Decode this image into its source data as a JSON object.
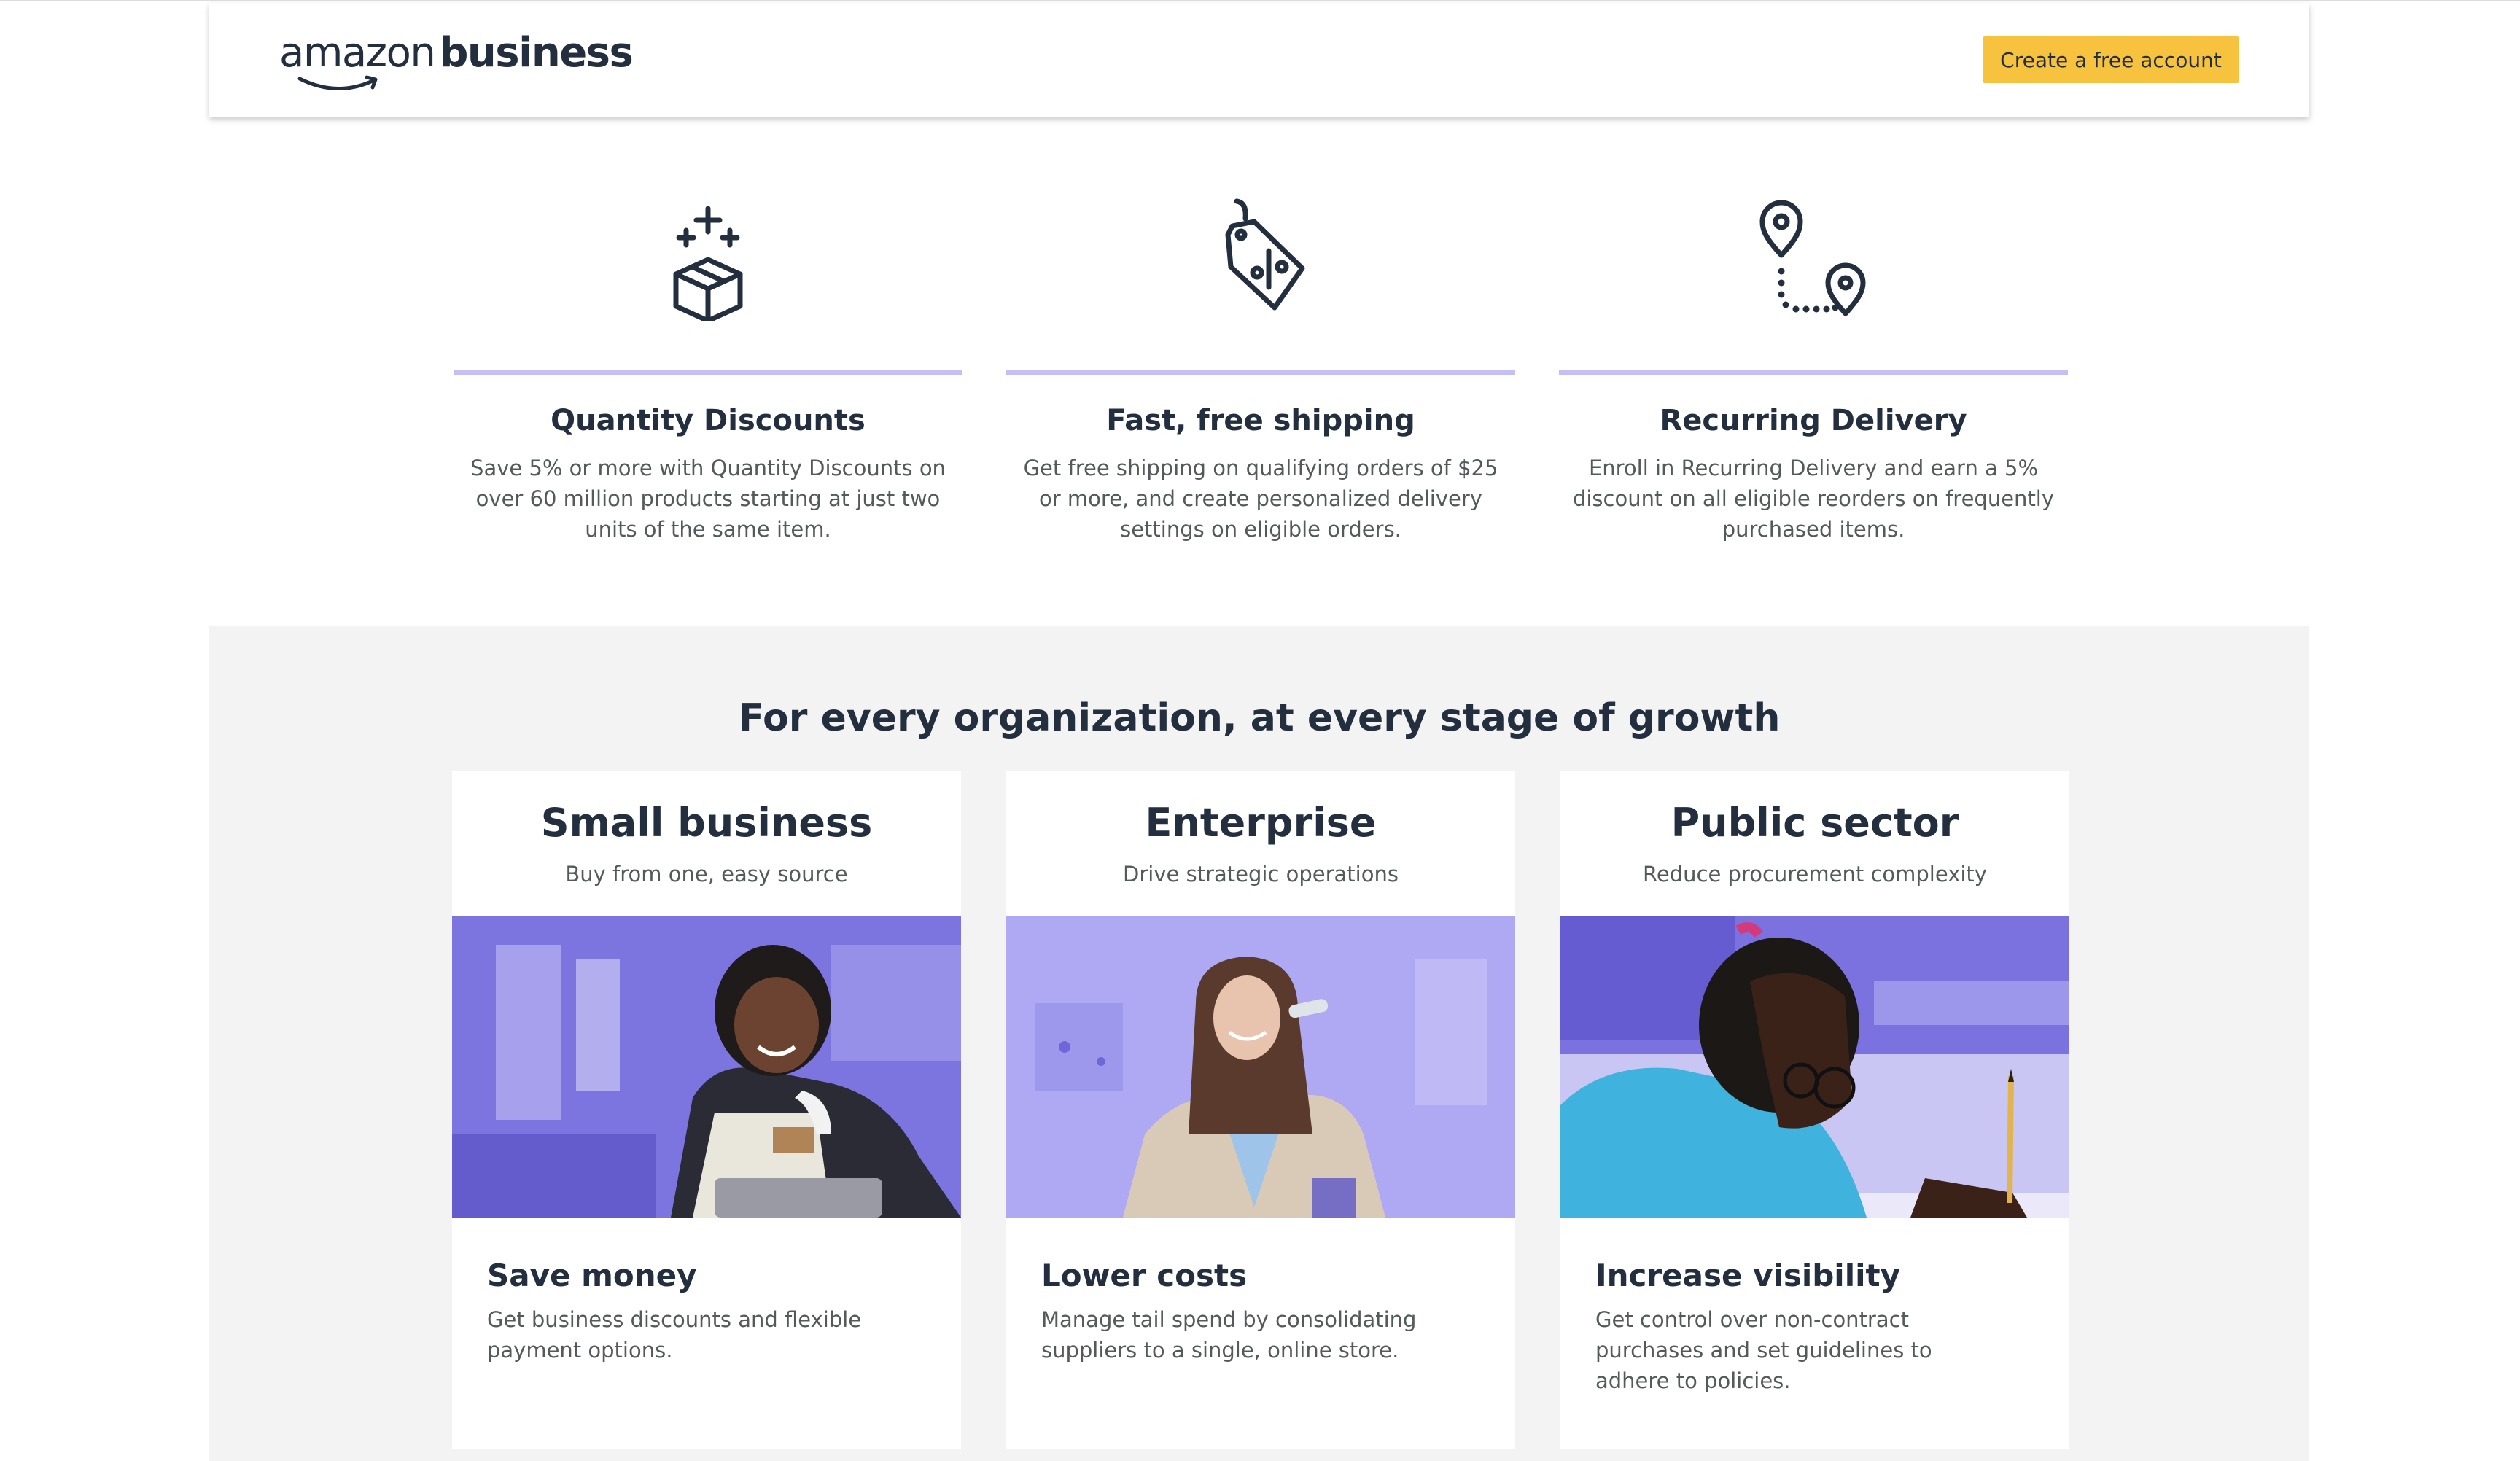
{
  "header": {
    "logo_amazon": "amazon",
    "logo_business": "business",
    "cta_label": "Create a free account"
  },
  "features": [
    {
      "icon": "box-sparkle-icon",
      "title": "Quantity Discounts",
      "text": "Save 5% or more with Quantity Discounts on over 60 million products starting at just two units of the same item."
    },
    {
      "icon": "price-tag-icon",
      "title": "Fast, free shipping",
      "text": "Get free shipping on qualifying orders of $25 or more, and create personalized delivery settings on eligible orders."
    },
    {
      "icon": "location-pins-icon",
      "title": "Recurring Delivery",
      "text": "Enroll in Recurring Delivery and earn a 5% discount on all eligible reorders on frequently purchased items."
    }
  ],
  "segments": {
    "heading": "For every organization, at every stage of growth",
    "cards": [
      {
        "title": "Small business",
        "subtitle": "Buy from one, easy source",
        "body_title": "Save money",
        "body_text": "Get business discounts and flexible payment options."
      },
      {
        "title": "Enterprise",
        "subtitle": "Drive strategic operations",
        "body_title": "Lower costs",
        "body_text": "Manage tail spend by consolidating suppliers to a single, online store."
      },
      {
        "title": "Public sector",
        "subtitle": "Reduce procurement complexity",
        "body_title": "Increase visibility",
        "body_text": "Get control over non-contract purchases and set guidelines to adhere to policies."
      }
    ]
  },
  "colors": {
    "accent_yellow": "#f7c23e",
    "lavender": "#c4c0f6",
    "photo_purple": "#7b72e0",
    "text_dark": "#232f3e",
    "text_grey": "#565959"
  }
}
